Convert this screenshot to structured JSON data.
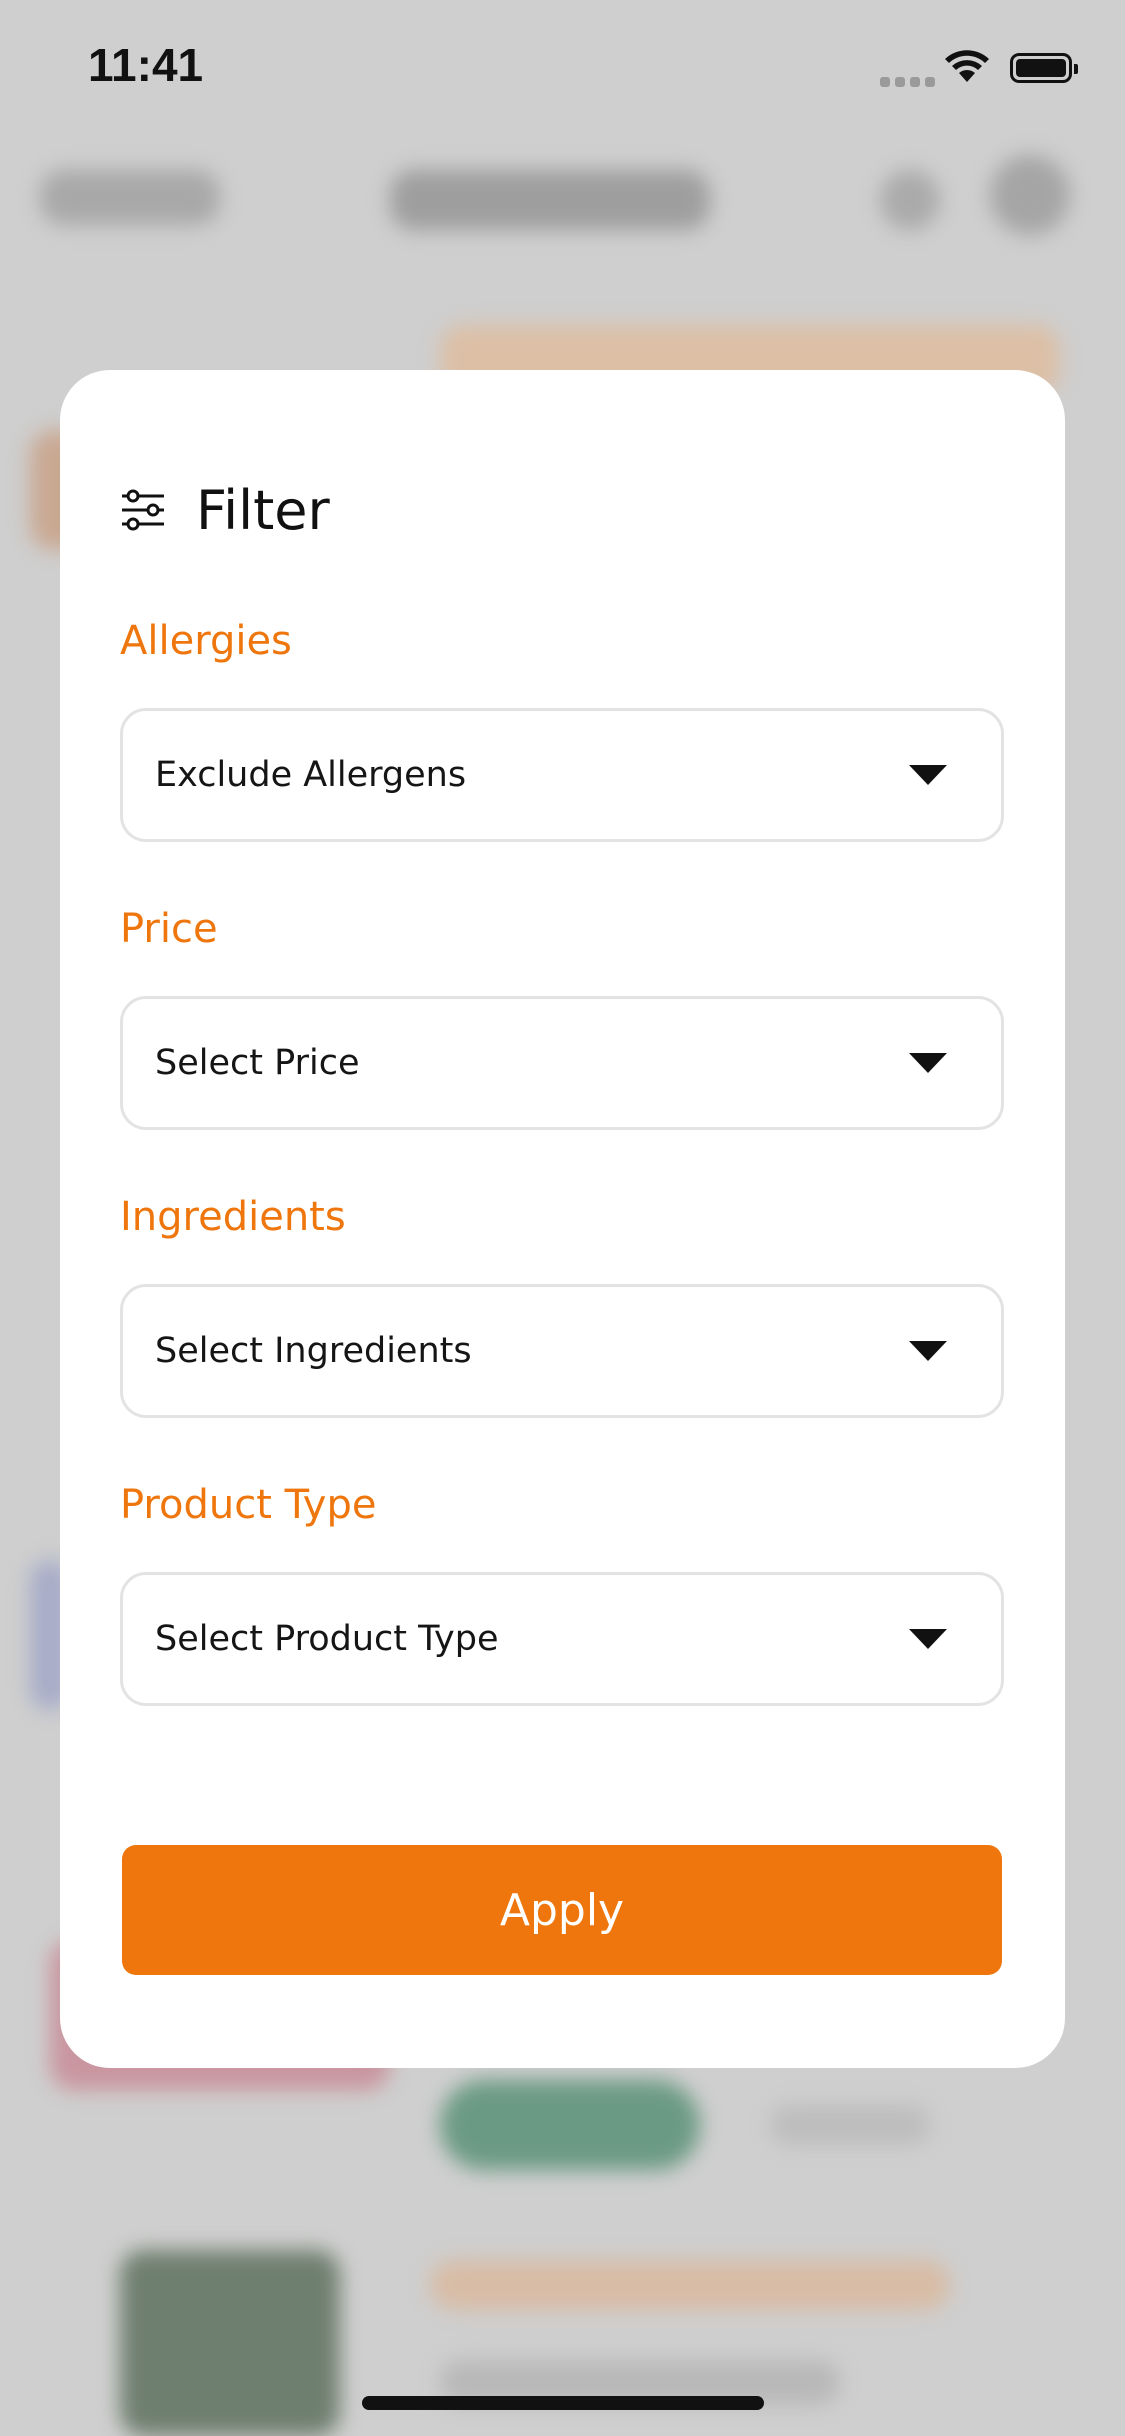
{
  "status_bar": {
    "time": "11:41",
    "signal_icon": "signal-dots-icon",
    "wifi_icon": "wifi-icon",
    "battery_icon": "battery-icon"
  },
  "filter_sheet": {
    "icon": "sliders-icon",
    "title": "Filter",
    "sections": [
      {
        "label": "Allergies",
        "placeholder": "Exclude Allergens",
        "icon": "caret-down-icon"
      },
      {
        "label": "Price",
        "placeholder": "Select Price",
        "icon": "caret-down-icon"
      },
      {
        "label": "Ingredients",
        "placeholder": "Select Ingredients",
        "icon": "caret-down-icon"
      },
      {
        "label": "Product Type",
        "placeholder": "Select Product Type",
        "icon": "caret-down-icon"
      }
    ],
    "apply_label": "Apply"
  },
  "colors": {
    "accent": "#ef760c",
    "backdrop": "#cfcfcf",
    "sheet": "#ffffff",
    "text": "#151515",
    "field_border": "#e3e3e3"
  }
}
